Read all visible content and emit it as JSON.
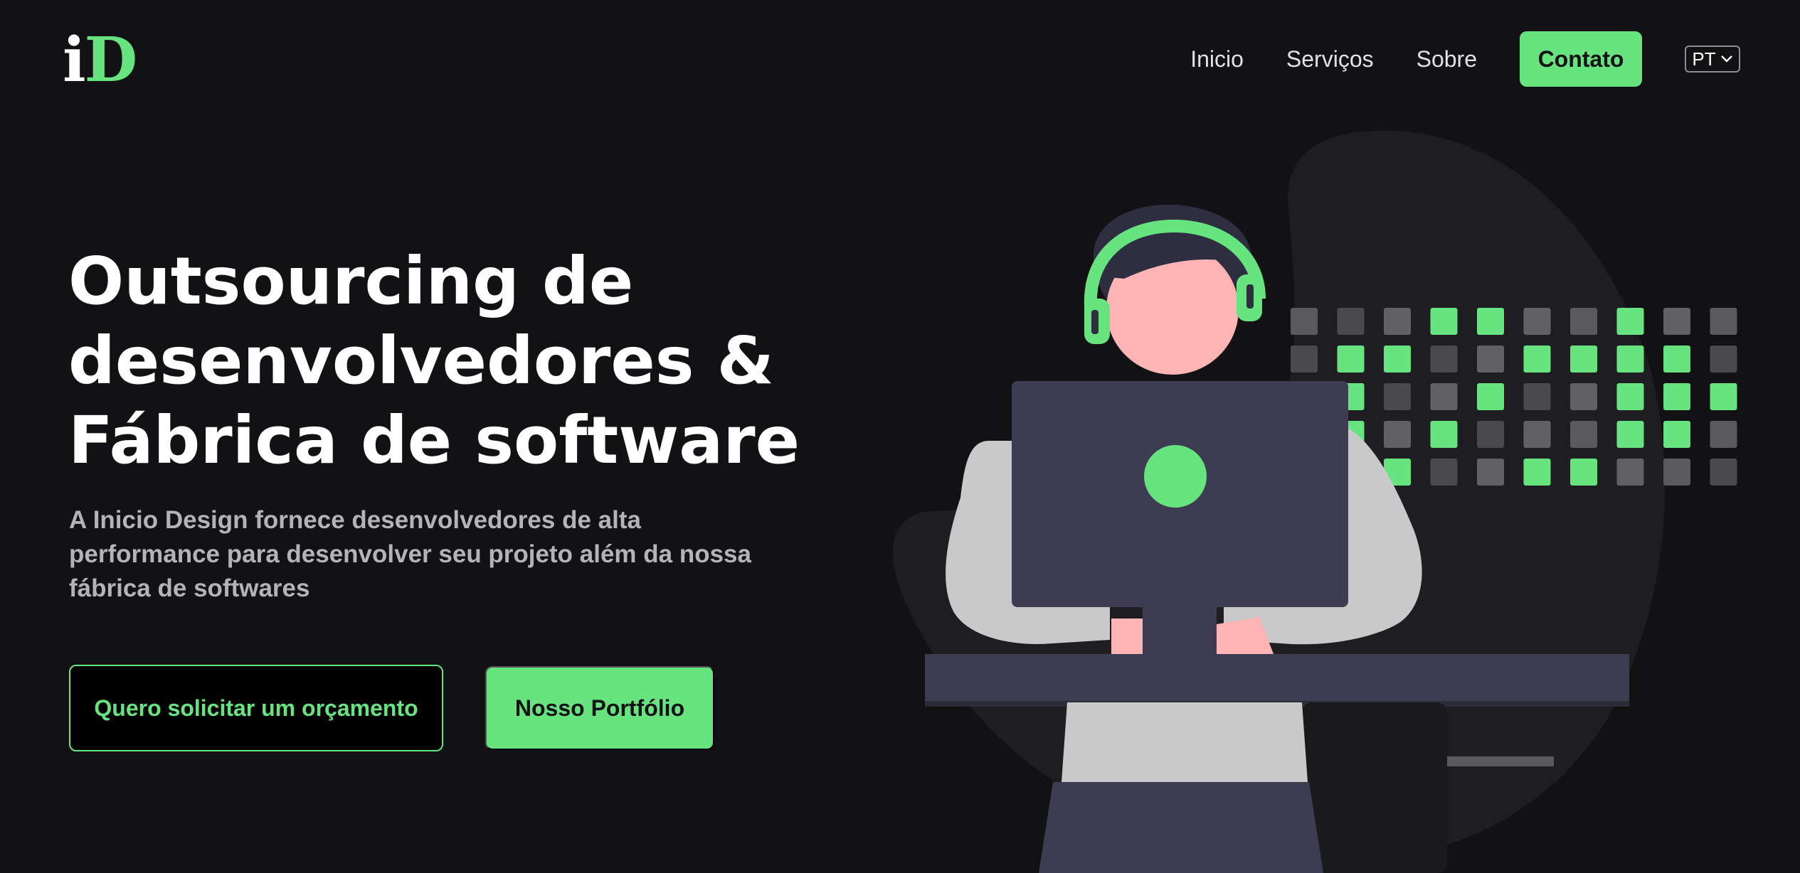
{
  "header": {
    "logo": {
      "letter_i": "i",
      "letter_d": "D"
    },
    "nav": [
      {
        "label": "Inicio"
      },
      {
        "label": "Serviços"
      },
      {
        "label": "Sobre"
      }
    ],
    "contact_label": "Contato",
    "language": {
      "selected": "PT",
      "icon": "chevron-down-icon"
    }
  },
  "hero": {
    "title_lines": [
      "Outsourcing de",
      "desenvolvedores &",
      "Fábrica de software"
    ],
    "subtitle_lines": [
      "A Inicio Design fornece desenvolvedores de alta",
      "performance para desenvolver seu projeto além da nossa",
      "fábrica de softwares"
    ],
    "primary_button": "Quero solicitar um orçamento",
    "secondary_button": "Nosso Portfólio"
  },
  "colors": {
    "background": "#121214",
    "accent": "#67e480",
    "text": "#ffffff",
    "muted_text": "#b3b3ba"
  }
}
